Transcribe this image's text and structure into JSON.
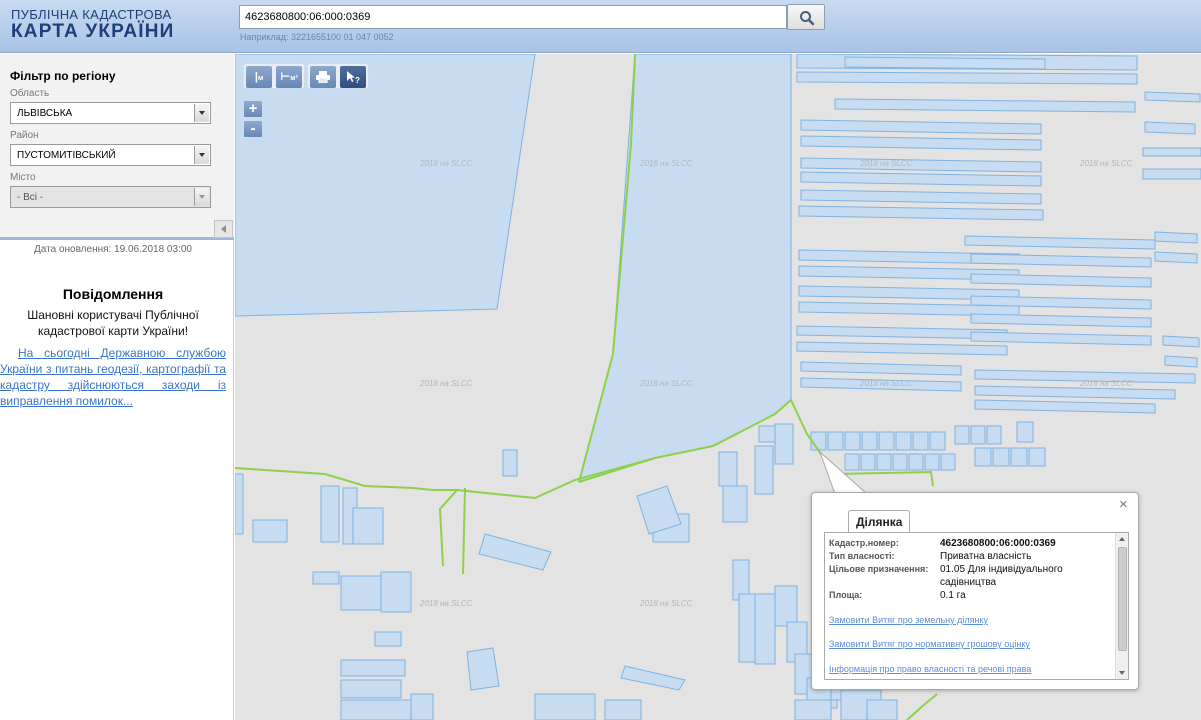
{
  "header": {
    "logo_line1": "ПУБЛІЧНА КАДАСТРОВА",
    "logo_line2": "КАРТА УКРАЇНИ",
    "search_value": "4623680800:06:000:0369",
    "search_hint": "Наприклад: 3221655100 01 047 0052"
  },
  "filter": {
    "title": "Фільтр по регіону",
    "region_label": "Область",
    "region_value": "ЛЬВІВСЬКА",
    "district_label": "Район",
    "district_value": "ПУСТОМИТІВСЬКИЙ",
    "city_label": "Місто",
    "city_value": "- Всі -"
  },
  "sidebar": {
    "update_date": "Дата оновлення: 19.06.2018 03:00",
    "notice_title": "Повідомлення",
    "notice_text": "Шановні користувачі Публічної кадастрової карти України!",
    "notice_link": "На сьогодні Державною службою України з питань геодезії, картографії та кадастру здійснюються заходи із виправлення помилок..."
  },
  "toolbar": {
    "ruler_label": "м",
    "area_label": "м²",
    "zoom_in": "+",
    "zoom_out": "-"
  },
  "map": {
    "watermark": "2018 на SLCC"
  },
  "popup": {
    "close": "×",
    "tab": "Ділянка",
    "rows": [
      {
        "label": "Кадастр.номер:",
        "value": "4623680800:06:000:0369"
      },
      {
        "label": "Тип власності:",
        "value": "Приватна власність"
      },
      {
        "label": "Цільове призначення:",
        "value": "01.05 Для індивідуального садівництва"
      },
      {
        "label": "Площа:",
        "value": "0.1 га"
      }
    ],
    "links": [
      "Замовити Витяг про земельну ділянку",
      "Замовити Витяг про нормативну грошову оцінку",
      "Інформація про право власності та речові права"
    ]
  },
  "colors": {
    "parcel_fill": "#c7dcf0",
    "parcel_stroke": "#7fb2e0",
    "boundary": "#8ed04a",
    "header": "#b5cbe9"
  }
}
